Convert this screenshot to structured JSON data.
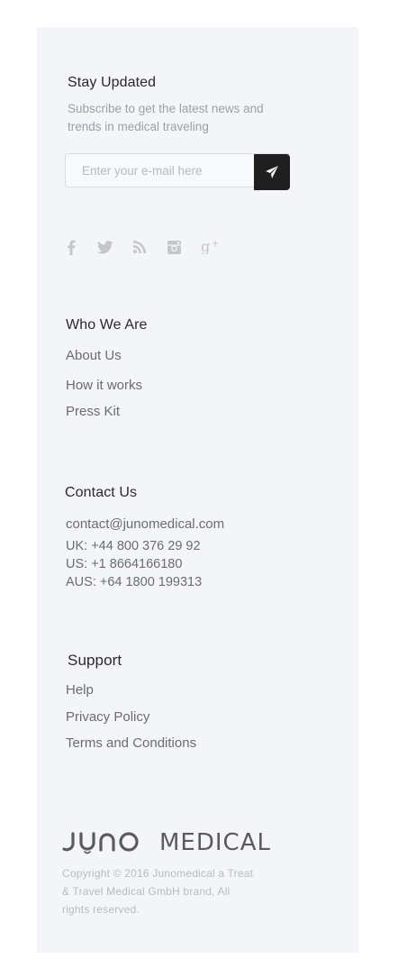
{
  "stay_updated": {
    "title": "Stay Updated",
    "subtitle": "Subscribe to get the latest news and trends in medical traveling",
    "email_placeholder": "Enter your e-mail here"
  },
  "social": {
    "icons": [
      "facebook-icon",
      "twitter-icon",
      "rss-icon",
      "instagram-icon",
      "google-plus-icon"
    ]
  },
  "who_we_are": {
    "title": "Who We Are",
    "links": [
      "About Us",
      "How it works",
      "Press Kit"
    ]
  },
  "contact_us": {
    "title": "Contact Us",
    "email": "contact@junomedical.com",
    "phones": [
      "UK: +44 800 376 29 92",
      "US: +1 8664166180",
      "AUS: +64 1800 199313"
    ]
  },
  "support": {
    "title": "Support",
    "links": [
      "Help",
      "Privacy Policy",
      "Terms and Conditions"
    ]
  },
  "footer": {
    "logo_text": "MEDICAL",
    "copyright": "Copyright © 2016 Junomedical a Treat & Travel Medical GmbH brand, All rights reserved."
  },
  "colors": {
    "panel_bg": "#f4f5f9",
    "button_bg": "#1f1f20",
    "link_text": "#6a6c72",
    "muted_text": "#9b9fa7",
    "icon_gray": "#c4c6cc"
  }
}
